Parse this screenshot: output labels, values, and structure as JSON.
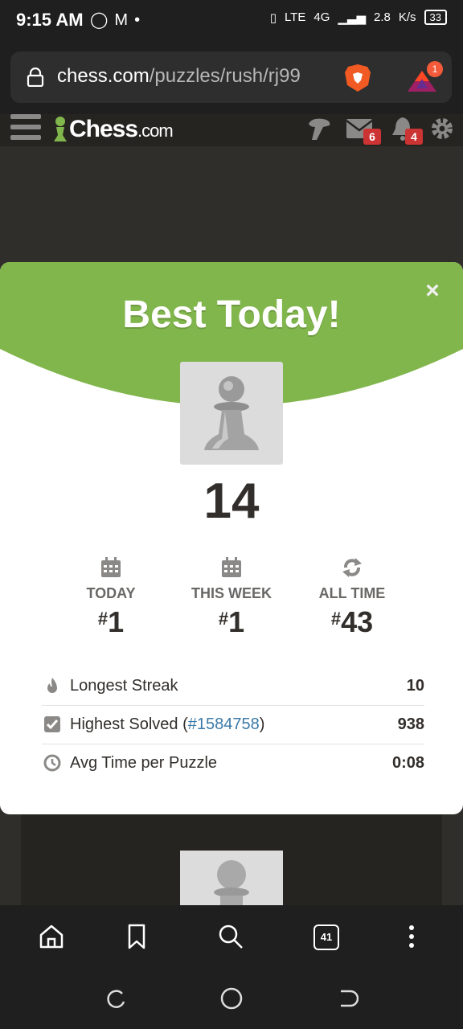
{
  "status_bar": {
    "time": "9:15 AM",
    "network_label": "LTE",
    "network_generation": "4G",
    "speed_value": "2.8",
    "speed_unit": "K/s",
    "battery": "33"
  },
  "browser": {
    "url_domain": "chess.com",
    "url_path": "/puzzles/rush/rj99",
    "rewards_badge": "1",
    "tabs_count": "41"
  },
  "site_header": {
    "logo_text": "Chess",
    "logo_suffix": ".com",
    "messages_badge": "6",
    "notifications_badge": "4"
  },
  "modal": {
    "title": "Best Today!",
    "close_glyph": "×",
    "score": "14",
    "ranks": [
      {
        "label": "TODAY",
        "value": "1",
        "icon": "calendar-icon"
      },
      {
        "label": "THIS WEEK",
        "value": "1",
        "icon": "calendar-icon"
      },
      {
        "label": "ALL TIME",
        "value": "43",
        "icon": "refresh-icon"
      }
    ],
    "rank_prefix": "#",
    "stats": [
      {
        "label": "Longest Streak",
        "value": "10",
        "icon": "flame-icon"
      },
      {
        "label": "Highest Solved (",
        "link": "#1584758",
        "label_end": ")",
        "value": "938",
        "icon": "checkbox-icon"
      },
      {
        "label": "Avg Time per Puzzle",
        "value": "0:08",
        "icon": "clock-icon"
      }
    ]
  },
  "colors": {
    "accent_green": "#81b64c",
    "badge_red": "#cc3333",
    "link_blue": "#3c7aa8"
  }
}
